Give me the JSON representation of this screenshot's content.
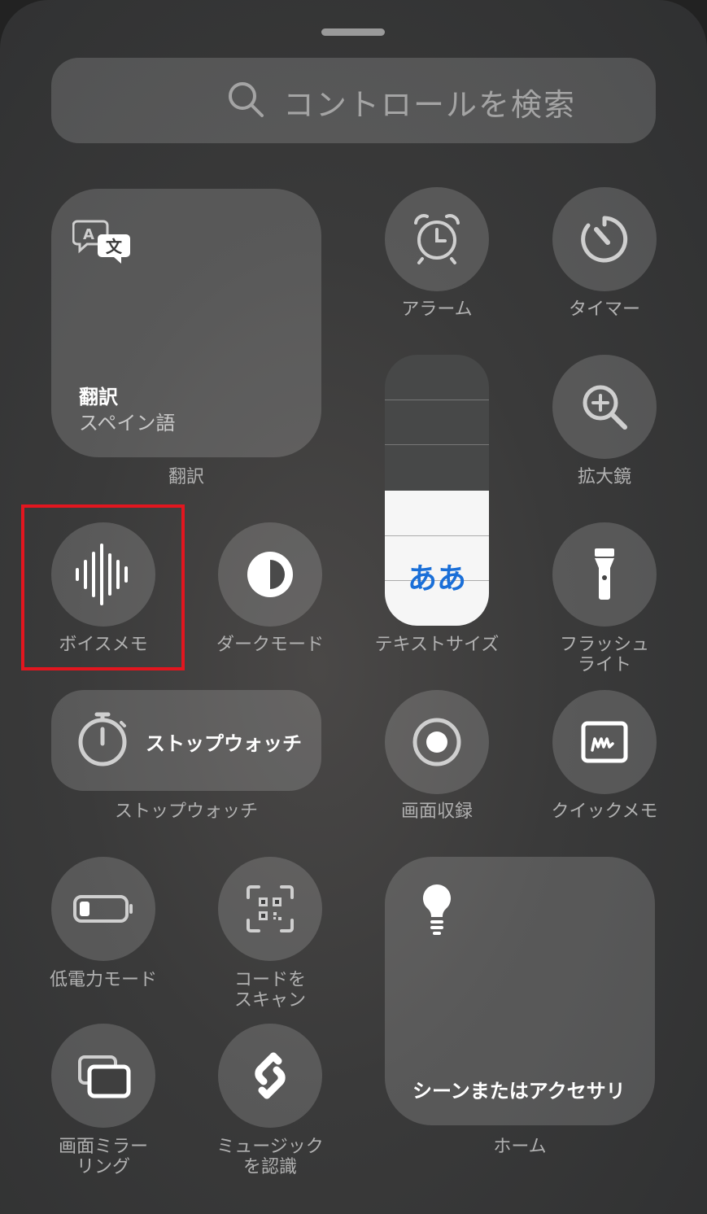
{
  "search": {
    "placeholder": "コントロールを検索"
  },
  "translate": {
    "title": "翻訳",
    "subtitle": "スペイン語",
    "label": "翻訳"
  },
  "alarm": {
    "label": "アラーム"
  },
  "timer": {
    "label": "タイマー"
  },
  "magnifier": {
    "label": "拡大鏡"
  },
  "text_size": {
    "label": "テキストサイズ",
    "glyph": "ああ",
    "level": 3,
    "steps": 6
  },
  "voice_memo": {
    "label": "ボイスメモ"
  },
  "dark_mode": {
    "label": "ダークモード"
  },
  "flashlight": {
    "label_line1": "フラッシュ",
    "label_line2": "ライト"
  },
  "stopwatch": {
    "title": "ストップウォッチ",
    "label": "ストップウォッチ"
  },
  "screen_record": {
    "label": "画面収録"
  },
  "quick_note": {
    "label": "クイックメモ"
  },
  "low_power": {
    "label": "低電力モード"
  },
  "scan_code": {
    "label_line1": "コードを",
    "label_line2": "スキャン"
  },
  "home": {
    "title": "シーンまたはアクセサリ",
    "label": "ホーム"
  },
  "screen_mirror": {
    "label_line1": "画面ミラー",
    "label_line2": "リング"
  },
  "shazam": {
    "label_line1": "ミュージック",
    "label_line2": "を認識"
  },
  "colors": {
    "highlight": "#e2161f",
    "text_size_accent": "#1a6fd8"
  }
}
